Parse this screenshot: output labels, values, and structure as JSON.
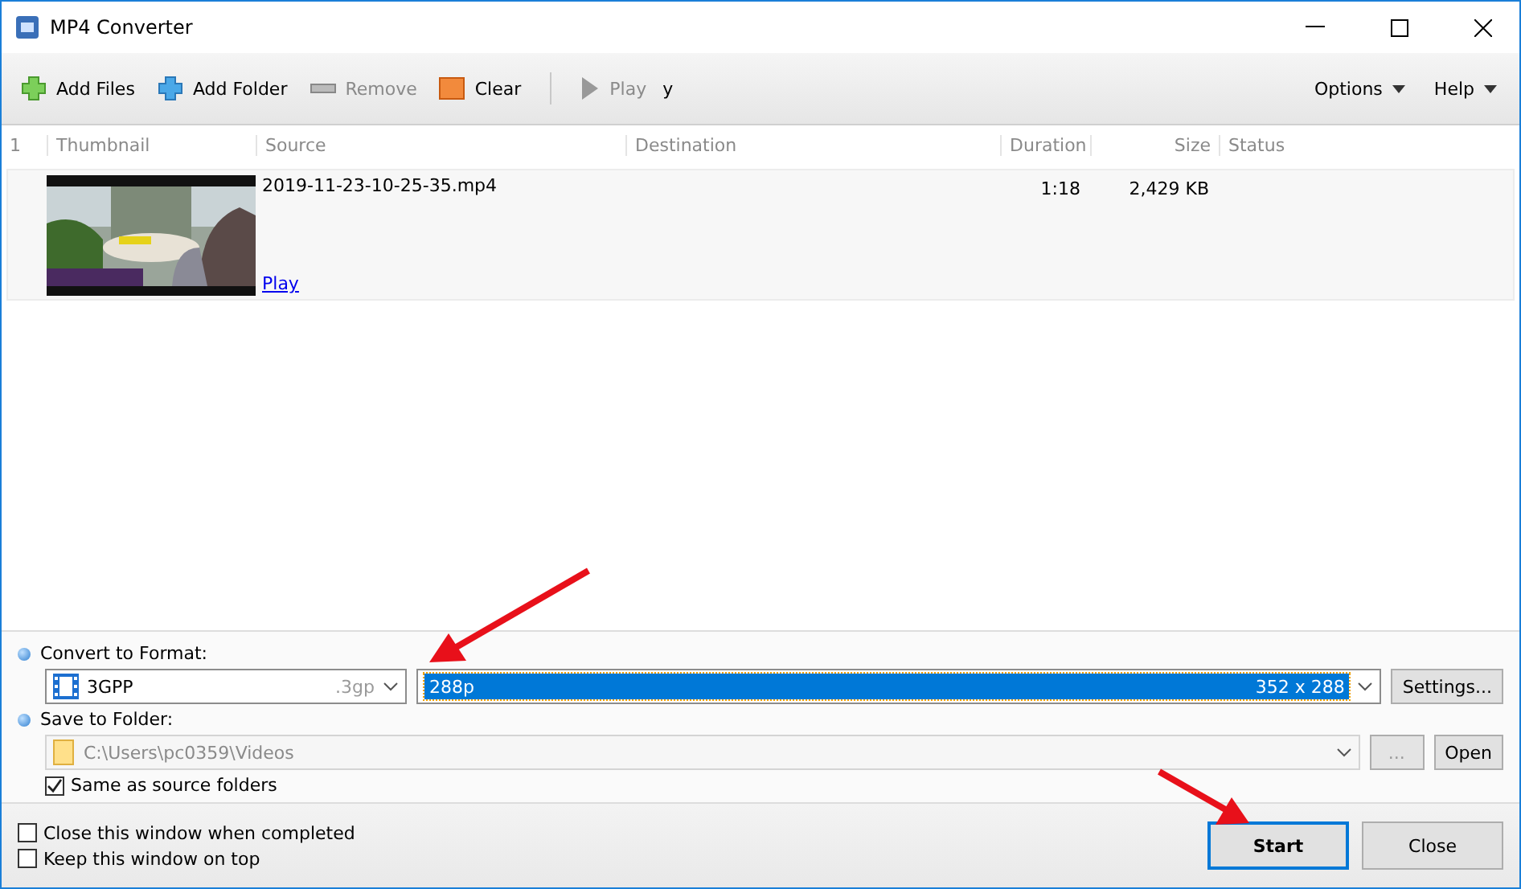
{
  "window": {
    "title": "MP4 Converter"
  },
  "toolbar": {
    "buttons": [
      {
        "kind": "add-files",
        "label": "Add Files",
        "disabled": false
      },
      {
        "kind": "add-folder",
        "label": "Add Folder",
        "disabled": false
      },
      {
        "kind": "remove",
        "label": "Remove",
        "disabled": true
      },
      {
        "kind": "clear",
        "label": "Clear",
        "disabled": false
      },
      {
        "kind": "play",
        "label": "Play",
        "disabled": true
      }
    ],
    "fragment": "y",
    "menus": [
      "Options",
      "Help"
    ]
  },
  "table": {
    "columns": [
      "1",
      "Thumbnail",
      "Source",
      "Destination",
      "Duration",
      "Size",
      "Status"
    ],
    "rows": [
      {
        "source": "2019-11-23-10-25-35.mp4",
        "play_link": "Play",
        "duration": "1:18",
        "size": "2,429 KB"
      }
    ]
  },
  "format": {
    "label": "Convert to Format:",
    "name": "3GPP",
    "extension": ".3gp",
    "preset": "288p",
    "resolution": "352 x 288",
    "settings_button": "Settings..."
  },
  "folder": {
    "label": "Save to Folder:",
    "path": "C:\\Users\\pc0359\\Videos",
    "disabled": true,
    "browse_button": "...",
    "open_button": "Open",
    "same_as_source": {
      "label": "Same as source folders",
      "checked": true
    }
  },
  "options": [
    {
      "label": "Close this window when completed",
      "checked": false
    },
    {
      "label": "Keep this window on top",
      "checked": false
    }
  ],
  "buttons": [
    {
      "label": "Start",
      "selected": true
    },
    {
      "label": "Close",
      "selected": false
    }
  ]
}
